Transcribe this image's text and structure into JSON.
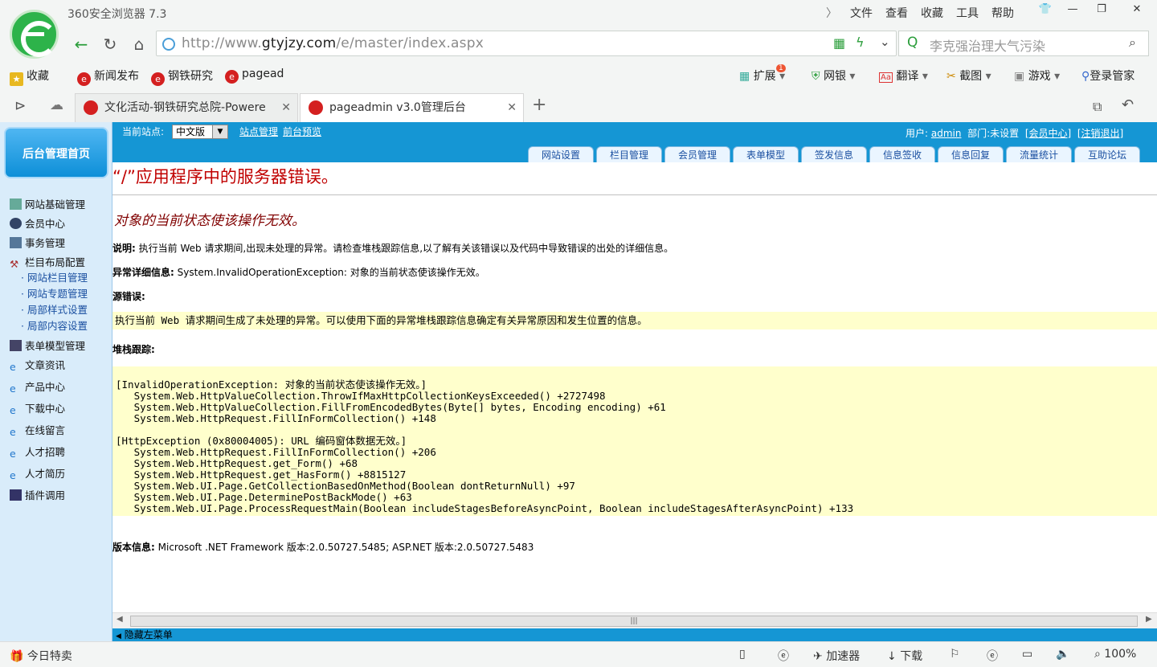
{
  "browser": {
    "title": "360安全浏览器 7.3",
    "menu": [
      "文件",
      "查看",
      "收藏",
      "工具",
      "帮助"
    ],
    "url_prefix": "http://www.",
    "url_host": "gtyjzy.com",
    "url_path": "/e/master/index.aspx",
    "search_placeholder": "李克强治理大气污染",
    "favorites": [
      "收藏",
      "新闻发布",
      "钢铁研究",
      "pagead"
    ],
    "tools": {
      "extend": "扩展",
      "extend_badge": "1",
      "bank": "网银",
      "translate": "翻译",
      "screenshot": "截图",
      "games": "游戏",
      "login": "登录管家"
    },
    "tabs": [
      {
        "label": "文化活动-钢铁研究总院-Powere"
      },
      {
        "label": "pageadmin v3.0管理后台"
      }
    ],
    "new_tab": "+"
  },
  "admin": {
    "home": "后台管理首页",
    "current_site_label": "当前站点:",
    "current_site_value": "中文版",
    "site_manage": "站点管理",
    "front_preview": "前台预览",
    "user_label": "用户:",
    "user_name": "admin",
    "dept_label": "部门:",
    "dept_value": "未设置",
    "member_center_link": "[会员中心]",
    "logout_link": "[注销退出]",
    "nav_tabs": [
      "网站设置",
      "栏目管理",
      "会员管理",
      "表单模型",
      "签发信息",
      "信息签收",
      "信息回复",
      "流量统计",
      "互助论坛"
    ],
    "sidebar": {
      "items": [
        {
          "label": "网站基础管理"
        },
        {
          "label": "会员中心"
        },
        {
          "label": "事务管理"
        },
        {
          "label": "栏目布局配置"
        }
      ],
      "sub_items": [
        "网站栏目管理",
        "网站专题管理",
        "局部样式设置",
        "局部内容设置"
      ],
      "items2": [
        {
          "label": "表单模型管理"
        },
        {
          "label": "文章资讯"
        },
        {
          "label": "产品中心"
        },
        {
          "label": "下载中心"
        },
        {
          "label": "在线留言"
        },
        {
          "label": "人才招聘"
        },
        {
          "label": "人才简历"
        },
        {
          "label": "插件调用"
        }
      ]
    },
    "hide_menu": "隐藏左菜单"
  },
  "error": {
    "title": "“/”应用程序中的服务器错误。",
    "subtitle": "对象的当前状态使该操作无效。",
    "desc_label": "说明:",
    "desc_text": "执行当前 Web 请求期间,出现未处理的异常。请检查堆栈跟踪信息,以了解有关该错误以及代码中导致错误的出处的详细信息。",
    "detail_label": "异常详细信息:",
    "detail_text": "System.InvalidOperationException: 对象的当前状态使该操作无效。",
    "source_label": "源错误:",
    "source_text": "执行当前 Web 请求期间生成了未处理的异常。可以使用下面的异常堆栈跟踪信息确定有关异常原因和发生位置的信息。",
    "stack_label": "堆栈跟踪:",
    "stack_text": "[InvalidOperationException: 对象的当前状态使该操作无效。]\n   System.Web.HttpValueCollection.ThrowIfMaxHttpCollectionKeysExceeded() +2727498\n   System.Web.HttpValueCollection.FillFromEncodedBytes(Byte[] bytes, Encoding encoding) +61\n   System.Web.HttpRequest.FillInFormCollection() +148\n\n[HttpException (0x80004005): URL 编码窗体数据无效。]\n   System.Web.HttpRequest.FillInFormCollection() +206\n   System.Web.HttpRequest.get_Form() +68\n   System.Web.HttpRequest.get_HasForm() +8815127\n   System.Web.UI.Page.GetCollectionBasedOnMethod(Boolean dontReturnNull) +97\n   System.Web.UI.Page.DeterminePostBackMode() +63\n   System.Web.UI.Page.ProcessRequestMain(Boolean includeStagesBeforeAsyncPoint, Boolean includeStagesAfterAsyncPoint) +133",
    "version_label": "版本信息:",
    "version_text": "Microsoft .NET Framework 版本:2.0.50727.5485; ASP.NET 版本:2.0.50727.5483"
  },
  "statusbar": {
    "deal": "今日特卖",
    "accelerator": "加速器",
    "download": "下载",
    "zoom": "100%"
  }
}
